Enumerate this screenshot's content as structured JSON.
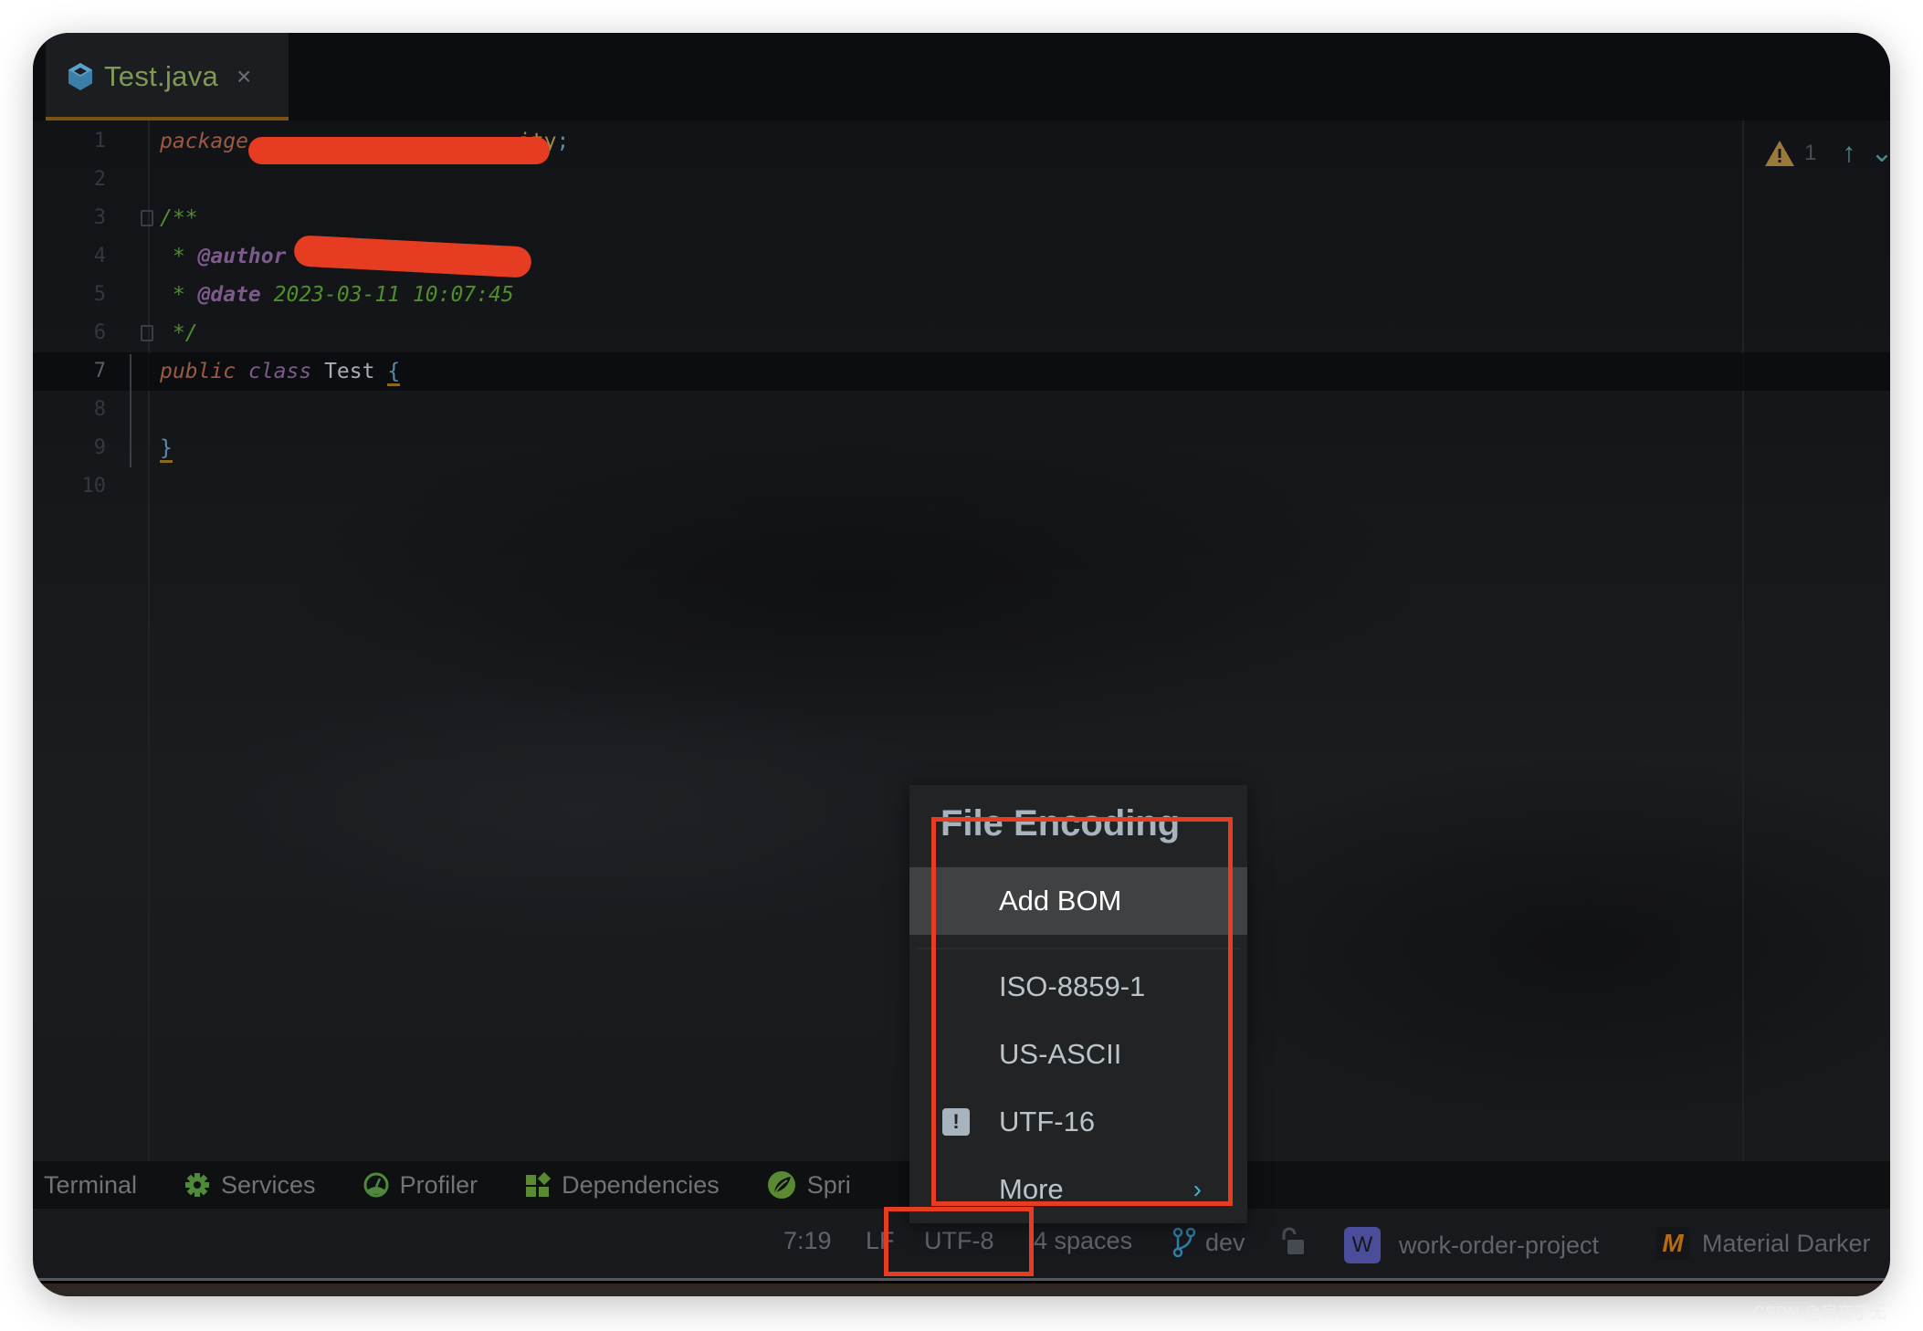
{
  "tab": {
    "filename": "Test.java",
    "close_glyph": "×",
    "icon": "java-class-icon"
  },
  "editor": {
    "line_numbers": [
      "1",
      "2",
      "3",
      "4",
      "5",
      "6",
      "7",
      "8",
      "9",
      "10"
    ],
    "current_line": 7,
    "lines": {
      "l1_keyword": "package",
      "l1_tail": "ity",
      "l1_semi": ";",
      "l3": "/**",
      "l4_star": " * ",
      "l4_tag": "@author",
      "l5_star": " * ",
      "l5_tag": "@date",
      "l5_value": " 2023-03-11 10:07:45",
      "l6": " */",
      "l7_public": "public",
      "l7_class": "class",
      "l7_name": "Test",
      "l7_brace": "{",
      "l9_brace": "}"
    },
    "inspection": {
      "warning_count": "1",
      "up_arrow": "↑",
      "down_arrow": "⌄"
    }
  },
  "toolbar": {
    "items": [
      {
        "label": "Terminal",
        "icon": "terminal-icon"
      },
      {
        "label": "Services",
        "icon": "gear-icon"
      },
      {
        "label": "Profiler",
        "icon": "gauge-icon"
      },
      {
        "label": "Dependencies",
        "icon": "dependencies-icon"
      },
      {
        "label": "Spri",
        "icon": "spring-leaf-icon"
      }
    ]
  },
  "statusbar": {
    "position": "7:19",
    "line_separator": "LF",
    "encoding": "UTF-8",
    "indent": "4 spaces",
    "branch": "dev",
    "project_badge": "W",
    "project": "work-order-project",
    "theme_badge": "M",
    "theme": "Material Darker"
  },
  "popup": {
    "title": "File Encoding",
    "items": [
      {
        "label": "Add BOM",
        "selected": true
      },
      {
        "label": "ISO-8859-1"
      },
      {
        "label": "US-ASCII"
      },
      {
        "label": "UTF-16",
        "badge": "!"
      },
      {
        "label": "More",
        "submenu_glyph": "›"
      }
    ]
  },
  "watermark": "CSDN @寂夜了无"
}
